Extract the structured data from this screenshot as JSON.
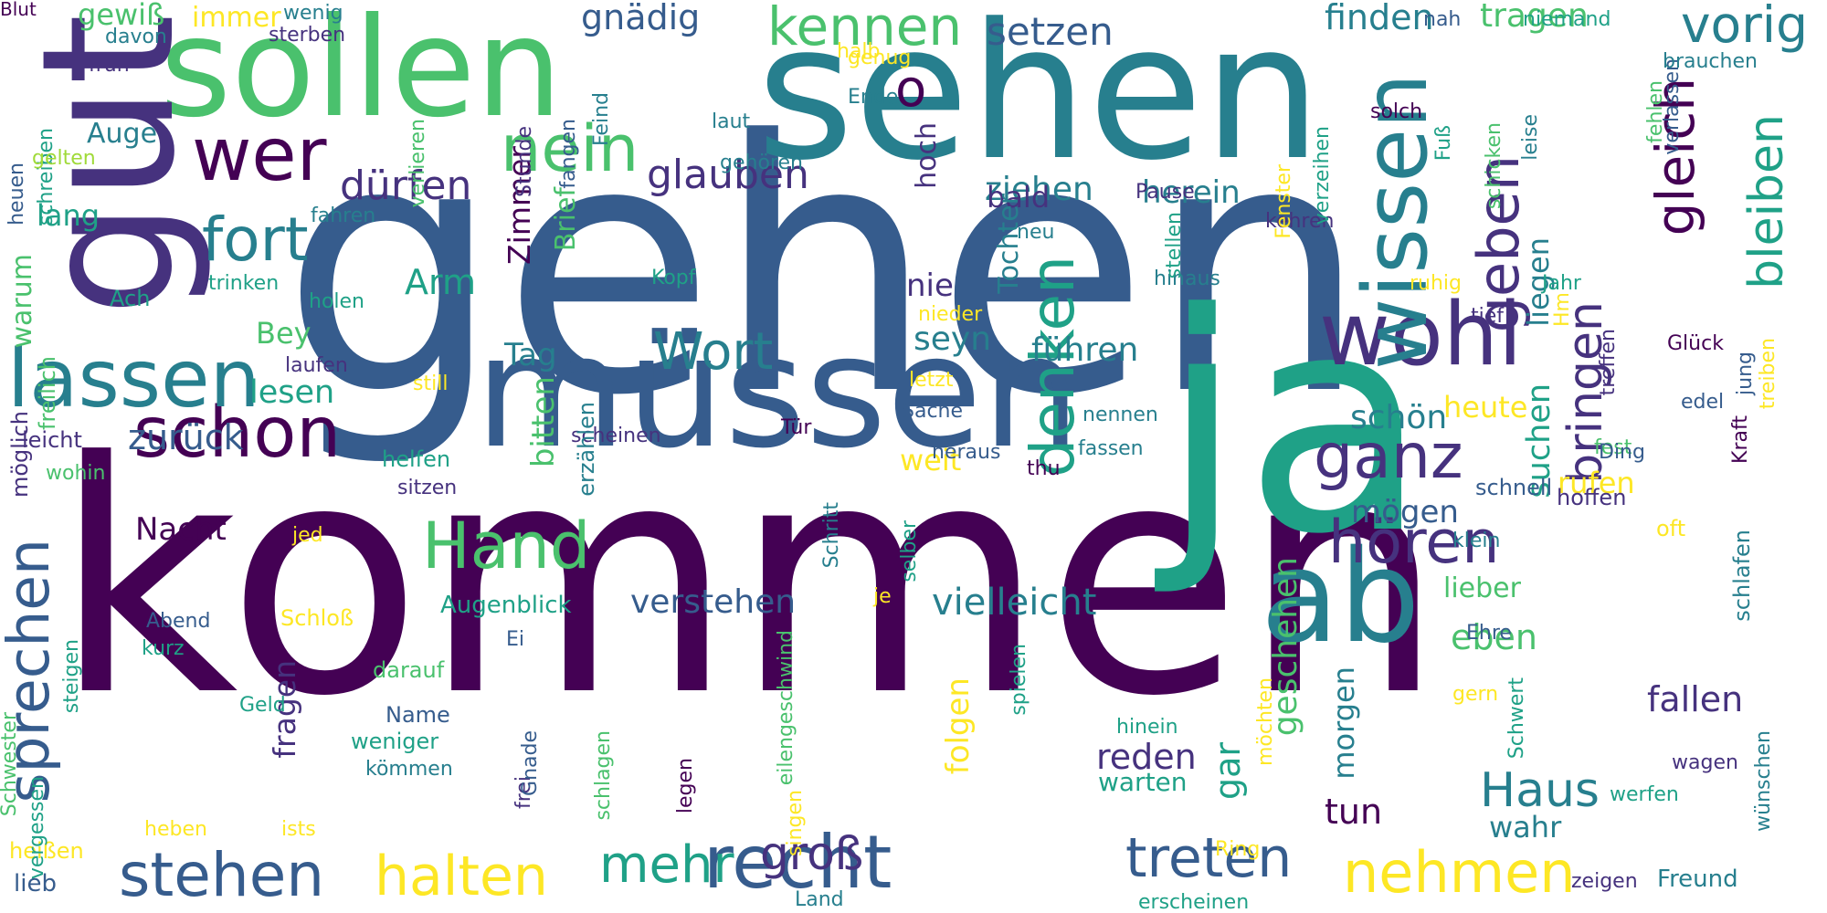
{
  "colors": {
    "background": "#ffffff",
    "palette": [
      "#440154",
      "#46327e",
      "#365c8d",
      "#277f8e",
      "#1fa187",
      "#4ac16d",
      "#a0da39",
      "#fde725"
    ]
  },
  "words": [
    {
      "text": "gehen"
    },
    {
      "text": "kommen"
    },
    {
      "text": "sehen"
    },
    {
      "text": "ja"
    },
    {
      "text": "müssen"
    },
    {
      "text": "sollen"
    },
    {
      "text": "gut"
    },
    {
      "text": "ab"
    },
    {
      "text": "schon"
    },
    {
      "text": "lassen"
    },
    {
      "text": "wer"
    },
    {
      "text": "nein"
    },
    {
      "text": "recht"
    },
    {
      "text": "stehen"
    },
    {
      "text": "wohl"
    },
    {
      "text": "wissen"
    },
    {
      "text": "Hand"
    },
    {
      "text": "treten"
    },
    {
      "text": "hören"
    },
    {
      "text": "ganz"
    },
    {
      "text": "nehmen"
    },
    {
      "text": "geben"
    },
    {
      "text": "kennen"
    },
    {
      "text": "mehr"
    },
    {
      "text": "halten"
    },
    {
      "text": "groß"
    },
    {
      "text": "sprechen"
    },
    {
      "text": "fort"
    },
    {
      "text": "Wort"
    },
    {
      "text": "denken"
    },
    {
      "text": "bringen"
    },
    {
      "text": "gleich"
    },
    {
      "text": "bleiben"
    },
    {
      "text": "vorig"
    },
    {
      "text": "o"
    },
    {
      "text": "Haus"
    },
    {
      "text": "glauben"
    },
    {
      "text": "dürfen"
    },
    {
      "text": "setzen"
    },
    {
      "text": "finden"
    },
    {
      "text": "tragen"
    },
    {
      "text": "gnädig"
    },
    {
      "text": "vielleicht"
    },
    {
      "text": "verstehen"
    },
    {
      "text": "zurück"
    },
    {
      "text": "Nacht"
    },
    {
      "text": "ziehen"
    },
    {
      "text": "herein"
    },
    {
      "text": "führen"
    },
    {
      "text": "seyn"
    },
    {
      "text": "Arm"
    },
    {
      "text": "Tag"
    },
    {
      "text": "lesen"
    },
    {
      "text": "Bey"
    },
    {
      "text": "nie"
    },
    {
      "text": "fallen"
    },
    {
      "text": "mögen"
    },
    {
      "text": "wahr"
    },
    {
      "text": "tun"
    },
    {
      "text": "reden"
    },
    {
      "text": "warten"
    },
    {
      "text": "eben"
    },
    {
      "text": "lieber"
    },
    {
      "text": "rufen"
    },
    {
      "text": "heute"
    },
    {
      "text": "schön"
    },
    {
      "text": "suchen"
    },
    {
      "text": "liegen"
    },
    {
      "text": "geschehen"
    },
    {
      "text": "gar"
    },
    {
      "text": "morgen"
    },
    {
      "text": "folgen"
    },
    {
      "text": "fragen"
    },
    {
      "text": "weit"
    },
    {
      "text": "bald"
    },
    {
      "text": "hoch"
    },
    {
      "text": "Tochter"
    },
    {
      "text": "Brief"
    },
    {
      "text": "bitten"
    },
    {
      "text": "Zimmer"
    },
    {
      "text": "warum"
    },
    {
      "text": "lang"
    },
    {
      "text": "gewiß"
    },
    {
      "text": "immer"
    },
    {
      "text": "Auge"
    },
    {
      "text": "Freund"
    },
    {
      "text": "lieb"
    },
    {
      "text": "heißen"
    },
    {
      "text": "zeigen"
    },
    {
      "text": "wagen"
    },
    {
      "text": "werfen"
    },
    {
      "text": "schlafen"
    },
    {
      "text": "Kraft"
    },
    {
      "text": "wünschen"
    },
    {
      "text": "treiben"
    },
    {
      "text": "jung"
    },
    {
      "text": "edel"
    },
    {
      "text": "Glück"
    },
    {
      "text": "fest"
    },
    {
      "text": "Ding"
    },
    {
      "text": "schnell"
    },
    {
      "text": "hoffen"
    },
    {
      "text": "klein"
    },
    {
      "text": "oft"
    },
    {
      "text": "Ehre"
    },
    {
      "text": "gern"
    },
    {
      "text": "Schwert"
    },
    {
      "text": "möchten"
    },
    {
      "text": "Ring"
    },
    {
      "text": "hinein"
    },
    {
      "text": "spielen"
    },
    {
      "text": "eilengeschwind"
    },
    {
      "text": "schlagen"
    },
    {
      "text": "legen"
    },
    {
      "text": "singen"
    },
    {
      "text": "frei"
    },
    {
      "text": "Gnade"
    },
    {
      "text": "Land"
    },
    {
      "text": "erscheinen"
    },
    {
      "text": "Ei"
    },
    {
      "text": "je"
    },
    {
      "text": "selber"
    },
    {
      "text": "Schritt"
    },
    {
      "text": "Augenblick"
    },
    {
      "text": "darauf"
    },
    {
      "text": "Name"
    },
    {
      "text": "weniger"
    },
    {
      "text": "kömmen"
    },
    {
      "text": "Geld"
    },
    {
      "text": "Schloß"
    },
    {
      "text": "jed"
    },
    {
      "text": "Abend"
    },
    {
      "text": "kurz"
    },
    {
      "text": "heben"
    },
    {
      "text": "ists"
    },
    {
      "text": "Schwester"
    },
    {
      "text": "vergessen"
    },
    {
      "text": "steigen"
    },
    {
      "text": "leicht"
    },
    {
      "text": "wohin"
    },
    {
      "text": "möglich"
    },
    {
      "text": "freilich"
    },
    {
      "text": "Ach"
    },
    {
      "text": "trinken"
    },
    {
      "text": "holen"
    },
    {
      "text": "laufen"
    },
    {
      "text": "still"
    },
    {
      "text": "helfen"
    },
    {
      "text": "sitzen"
    },
    {
      "text": "scheinen"
    },
    {
      "text": "erzählen"
    },
    {
      "text": "Tür"
    },
    {
      "text": "heraus"
    },
    {
      "text": "thu"
    },
    {
      "text": "fassen"
    },
    {
      "text": "nennen"
    },
    {
      "text": "Sache"
    },
    {
      "text": "letzt"
    },
    {
      "text": "nieder"
    },
    {
      "text": "hinaus"
    },
    {
      "text": "Kopf"
    },
    {
      "text": "ruhig"
    },
    {
      "text": "Jahr"
    },
    {
      "text": "tief"
    },
    {
      "text": "Hm"
    },
    {
      "text": "treffen"
    },
    {
      "text": "kehren"
    },
    {
      "text": "neu"
    },
    {
      "text": "Pause"
    },
    {
      "text": "gehören"
    },
    {
      "text": "stellen"
    },
    {
      "text": "Fenster"
    },
    {
      "text": "verzeihen"
    },
    {
      "text": "solch"
    },
    {
      "text": "Fuß"
    },
    {
      "text": "schicken"
    },
    {
      "text": "leise"
    },
    {
      "text": "fehlen"
    },
    {
      "text": "verlassen"
    },
    {
      "text": "brauchen"
    },
    {
      "text": "niemand"
    },
    {
      "text": "nah"
    },
    {
      "text": "genug"
    },
    {
      "text": "halb"
    },
    {
      "text": "Ende"
    },
    {
      "text": "laut"
    },
    {
      "text": "Feind"
    },
    {
      "text": "fangen"
    },
    {
      "text": "Stunde"
    },
    {
      "text": "verlieren"
    },
    {
      "text": "wenig"
    },
    {
      "text": "sterben"
    },
    {
      "text": "davon"
    },
    {
      "text": "früh"
    },
    {
      "text": "heuen"
    },
    {
      "text": "schreiben"
    },
    {
      "text": "gelten"
    },
    {
      "text": "fahren"
    },
    {
      "text": "Blut"
    }
  ]
}
